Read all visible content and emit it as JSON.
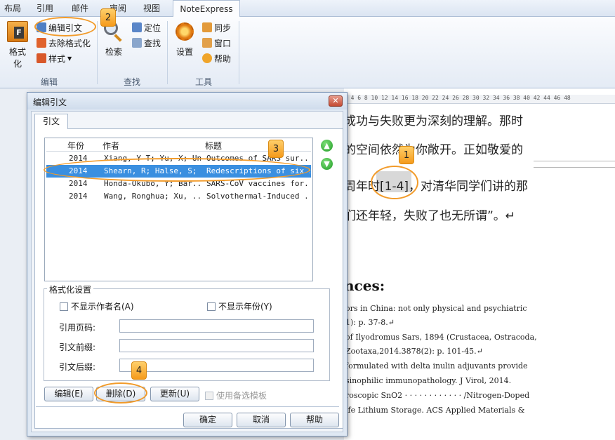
{
  "ribbon": {
    "tabs": [
      "布局",
      "引用",
      "邮件",
      "审阅",
      "视图",
      "NoteExpress"
    ],
    "format_label": "格式化",
    "edit_cite_label": "编辑引文",
    "remove_format_label": "去除格式化",
    "style_label": "样式",
    "edit_group": "编辑",
    "search_label": "检索",
    "locate_label": "定位",
    "find_label": "查找",
    "find_group": "查找",
    "settings_label": "设置",
    "sync_label": "同步",
    "window_label": "窗口",
    "help_label": "帮助",
    "tools_group": "工具"
  },
  "ruler": "2  4  6  8  10  12  14  16  18  20  22  24  26  28  30  32  34  36  38  40  42  44  46  48",
  "document": {
    "lines": [
      "成功与失败更为深刻的理解。那时",
      "的空间依然为你敞开。正如敬爱的",
      "周年时[1-4]，对清华同学们讲的那",
      "们还年轻，失败了也无所谓”。↵"
    ],
    "refs_heading": "nces:",
    "refs": [
      "ors in China: not only physical and psychiatric",
      "1): p. 37-8.↵",
      "of Ilyodromus Sars, 1894 (Crustacea, Ostracoda,",
      "Zootaxa,2014.3878(2): p. 101-45.↵",
      "formulated with delta inulin adjuvants provide",
      "sinophilic immunopathology. J Virol, 2014.",
      "roscopic SnO2 · · · · · · · · · · · · /Nitrogen-Doped",
      "ife Lithium Storage. ACS Applied Materials &"
    ]
  },
  "dialog": {
    "title": "编辑引文",
    "close": "✕",
    "tab": "引文",
    "columns": [
      "年份",
      "作者",
      "标题"
    ],
    "rows": [
      {
        "year": "2014",
        "author": "Xiang, Y T; Yu, X; Un...",
        "title": "Outcomes of SARS sur..."
      },
      {
        "year": "2014",
        "author": "Shearn, R; Halse, S; ...",
        "title": "Redescriptions of six s..."
      },
      {
        "year": "2014",
        "author": "Honda-Okubo, Y; Bar...",
        "title": "SARS-CoV vaccines for..."
      },
      {
        "year": "2014",
        "author": "Wang, Ronghua; Xu, ...",
        "title": "Solvothermal-Induced ..."
      }
    ],
    "selected_row": 1,
    "format_settings": "格式化设置",
    "hide_author": "不显示作者名(A)",
    "hide_year": "不显示年份(Y)",
    "cite_pages": "引用页码:",
    "cite_prefix": "引文前缀:",
    "cite_suffix": "引文后缀:",
    "edit_btn": "编辑(E)",
    "delete_btn": "删除(D)",
    "update_btn": "更新(U)",
    "use_alt_template": "使用备选模板",
    "ok_btn": "确定",
    "cancel_btn": "取消",
    "help_btn": "帮助"
  },
  "annotations": [
    "1",
    "2",
    "3",
    "4"
  ],
  "colors": {
    "selection": "#3a8fe0",
    "annotation": "#f29b2a"
  }
}
